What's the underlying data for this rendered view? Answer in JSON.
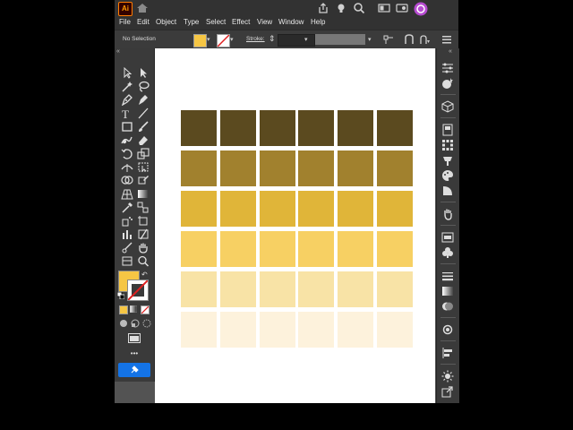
{
  "app": {
    "logo_text": "Ai"
  },
  "menu": {
    "items": [
      "File",
      "Edit",
      "Object",
      "Type",
      "Select",
      "Effect",
      "View",
      "Window",
      "Help"
    ]
  },
  "control_bar": {
    "selection_label": "No Selection",
    "stroke_label": "Stroke:",
    "fill_color": "#f6c644"
  },
  "toolbar": {
    "more_label": "•••",
    "fill_color": "#f6c644"
  },
  "swatch_grid": {
    "rows": [
      {
        "color": "#5b4a1f",
        "count": 6
      },
      {
        "color": "#a1812e",
        "count": 6
      },
      {
        "color": "#e0b539",
        "count": 6
      },
      {
        "color": "#f7d063",
        "count": 6
      },
      {
        "color": "#f8e3a6",
        "count": 6
      },
      {
        "color": "#fdf2dc",
        "count": 6
      }
    ]
  },
  "icons": {
    "top": [
      "home-icon",
      "share-icon",
      "lightbulb-icon",
      "search-icon",
      "arrange-icon",
      "window-icon",
      "profile-icon"
    ],
    "right_panel": [
      "properties-icon",
      "libraries-icon",
      "cube-icon",
      "layers-icon",
      "grid-icon",
      "brush-icon",
      "palette-icon",
      "shape-icon",
      "hand-icon",
      "swatches-icon",
      "club-icon",
      "stroke-lines-icon",
      "gradient-icon",
      "transparency-icon",
      "appearance-icon",
      "align-icon",
      "sun-icon",
      "export-icon"
    ]
  }
}
